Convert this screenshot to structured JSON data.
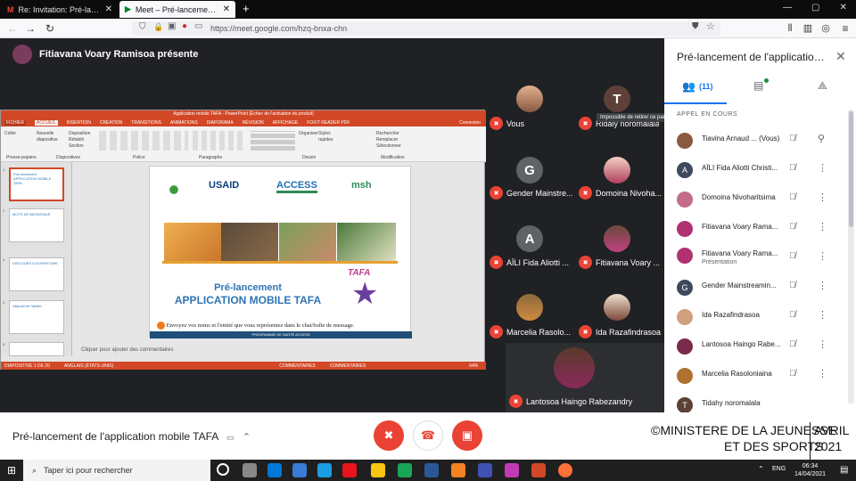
{
  "browser": {
    "tabs": [
      {
        "title": "Re: Invitation: Pré-lancement d",
        "active": false
      },
      {
        "title": "Meet – Pré-lancement de l'",
        "active": true
      }
    ],
    "new_tab": "+",
    "url": "https://meet.google.com/hzq-bnxa-chn",
    "window_controls": [
      "—",
      "▢",
      "✕"
    ]
  },
  "presenter": {
    "label": "Fitiavana Voary Ramisoa présente"
  },
  "ppt": {
    "title_bar": "Application mobile TAFA - PowerPoint (Échec de l'activation du produit)",
    "menu": [
      "FICHIER",
      "ACCUEIL",
      "INSERTION",
      "CRÉATION",
      "TRANSITIONS",
      "ANIMATIONS",
      "DIAPORAMA",
      "RÉVISION",
      "AFFICHAGE",
      "FOXIT READER PDF"
    ],
    "connexion": "Connexion",
    "ribbon_groups": [
      "Presse-papiers",
      "Diapositives",
      "Police",
      "Paragraphe",
      "Dessin",
      "Modification"
    ],
    "ribbon_items": [
      "Coller",
      "Nouvelle diapositive",
      "Disposition",
      "Rétablir",
      "Section",
      "Organiser",
      "Styles rapides",
      "Rechercher",
      "Remplacer",
      "Sélectionner"
    ],
    "thumb_numbers": [
      "1",
      "2",
      "3",
      "4",
      "5"
    ],
    "thumb_texts": [
      "Pré-lancement APPLICATION MOBILE TAFA",
      "MOTS DE BIENVENUE",
      "DISCOURS D'OUVERTURE",
      "Objectif de l'atelier",
      ""
    ],
    "comments_hint": "Cliquer pour ajouter des commentaires",
    "status": [
      "DIAPOSITIVE 1 DE 20",
      "ANGLAIS (ÉTATS-UNIS)",
      "COMMENTAIRES",
      "COMMENTAIRES",
      "64%"
    ]
  },
  "slide": {
    "logos": [
      "USAID",
      "ACCESS",
      "msh"
    ],
    "logo_colors": {
      "usaid": "#0a3d7a",
      "access": "#1f6fb5",
      "msh": "#2e8b57"
    },
    "title_line1": "Pré-lancement",
    "title_line2": "APPLICATION MOBILE TAFA",
    "tafa_logo": "TAFA",
    "message": "Envoyez vos noms et l'entité que vous représentez dans le chat/boîte de message.",
    "footer": "PROGRAMME DE SANTÉ ACCESS"
  },
  "tiles": [
    {
      "name": "Vous",
      "avatar": "photo",
      "muted": true
    },
    {
      "name": "Ridaly noromalala",
      "avatar": "T",
      "muted": true
    },
    {
      "name": "Gender Mainstre...",
      "avatar": "G",
      "muted": true
    },
    {
      "name": "Domoina Nivoha...",
      "avatar": "photo",
      "muted": true
    },
    {
      "name": "AÏLI Fida Aliotti ...",
      "avatar": "A",
      "muted": true
    },
    {
      "name": "Fitiavana Voary ...",
      "avatar": "photo",
      "muted": true
    },
    {
      "name": "Marcelia Rasolo...",
      "avatar": "photo",
      "muted": true
    },
    {
      "name": "Ida Razafindrasoa",
      "avatar": "photo",
      "muted": true
    },
    {
      "name": "Lantosoa Haingo Rabezandry",
      "avatar": "photo",
      "muted": true
    }
  ],
  "tooltip": "Impossible de retirer ce participant",
  "panel": {
    "title": "Pré-lancement de l'application m...",
    "close": "✕",
    "people_count": "(11)",
    "section": "APPEL EN COURS",
    "participants": [
      {
        "name": "Tiavina Arnaud ... (Vous)",
        "initial": "",
        "sub": "",
        "pin": true
      },
      {
        "name": "AÏLI Fida Aliotti Christi...",
        "initial": "A",
        "sub": ""
      },
      {
        "name": "Domoina Nivoharitsima",
        "initial": "",
        "sub": ""
      },
      {
        "name": "Fitiavana Voary Rama...",
        "initial": "",
        "sub": ""
      },
      {
        "name": "Fitiavana Voary Rama...",
        "initial": "",
        "sub": "Présentation"
      },
      {
        "name": "Gender Mainstreamin...",
        "initial": "G",
        "sub": ""
      },
      {
        "name": "Ida Razafindrasoa",
        "initial": "",
        "sub": ""
      },
      {
        "name": "Lantosoa Haingo Rabe...",
        "initial": "",
        "sub": ""
      },
      {
        "name": "Marcelia Rasoloniaina",
        "initial": "",
        "sub": ""
      },
      {
        "name": "Tidahy noromalala",
        "initial": "T",
        "sub": ""
      }
    ]
  },
  "bottom": {
    "meeting_name": "Pré-lancement de l'application mobile TAFA",
    "controls": {
      "mic": "mic-off",
      "hangup": "call-end",
      "camera": "videocam-off"
    }
  },
  "watermark": {
    "line1": "©MINISTERE DE LA JEUNESSE",
    "line2": "ET DES SPORTS",
    "month": "AVRIL",
    "year": "2021"
  },
  "taskbar": {
    "search_placeholder": "Taper ici pour rechercher",
    "lang": "ENG",
    "time": "06:34",
    "date": "14/04/2021"
  },
  "colors": {
    "red": "#ea4335",
    "blue": "#1a73e8",
    "ppt_red": "#d24726"
  }
}
